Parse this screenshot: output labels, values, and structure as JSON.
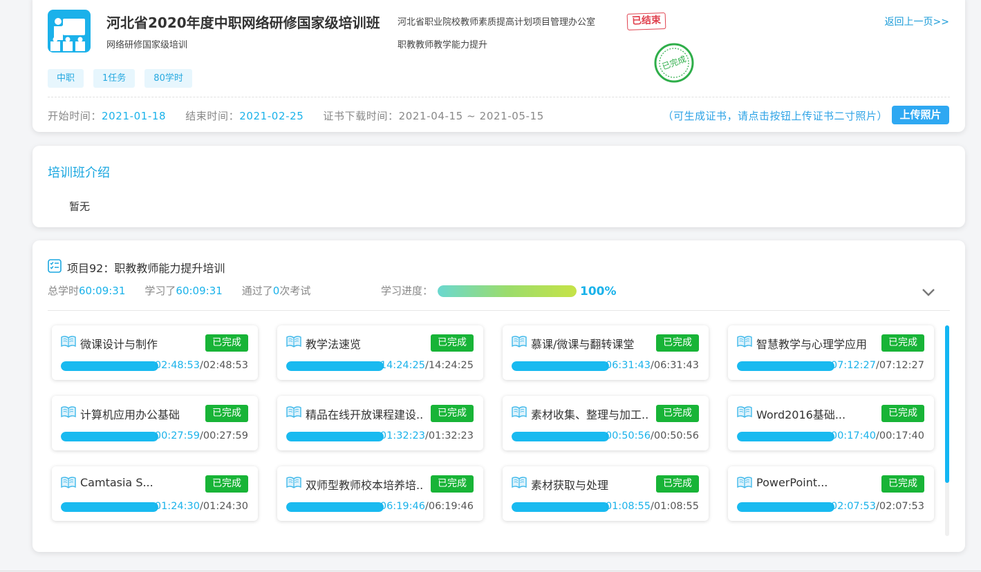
{
  "header": {
    "title": "河北省2020年度中职网络研修国家级培训班",
    "subtitle": "网络研修国家级培训",
    "organization": "河北省职业院校教师素质提高计划项目管理办公室",
    "status_badge": "已结束",
    "category": "职教教师教学能力提升",
    "back_link": "返回上一页>>",
    "stamp_text": "已完成",
    "tags": [
      "中职",
      "1任务",
      "80学时"
    ],
    "start_label": "开始时间：",
    "start_date": "2021-01-18",
    "end_label": "结束时间：",
    "end_date": "2021-02-25",
    "cert_label": "证书下载时间：",
    "cert_range": "2021-04-15 ~ 2021-05-15",
    "cert_note": "（可生成证书，请点击按钮上传证书二寸照片）",
    "upload_button": "上传照片"
  },
  "intro": {
    "title": "培训班介绍",
    "content": "暂无"
  },
  "project": {
    "title": "项目92：职教教师能力提升培训",
    "total_label": "总学时",
    "total_value": "60:09:31",
    "learned_label": "学习了",
    "learned_value": "60:09:31",
    "exam_prefix": "通过了",
    "exam_count": "0",
    "exam_suffix": "次考试",
    "progress_label": "学习进度：",
    "progress_fraction": 1.0,
    "progress_text": "100%"
  },
  "courses": [
    {
      "title": "微课设计与制作",
      "status": "已完成",
      "learned": "02:48:53",
      "total": "/02:48:53",
      "progress": 1.0
    },
    {
      "title": "教学法速览",
      "status": "已完成",
      "learned": "14:24:25",
      "total": "/14:24:25",
      "progress": 1.0
    },
    {
      "title": "慕课/微课与翻转课堂",
      "status": "已完成",
      "learned": "06:31:43",
      "total": "/06:31:43",
      "progress": 1.0
    },
    {
      "title": "智慧教学与心理学应用",
      "status": "已完成",
      "learned": "07:12:27",
      "total": "/07:12:27",
      "progress": 1.0
    },
    {
      "title": "计算机应用办公基础",
      "status": "已完成",
      "learned": "00:27:59",
      "total": "/00:27:59",
      "progress": 1.0
    },
    {
      "title": "精品在线开放课程建设...",
      "status": "已完成",
      "learned": "01:32:23",
      "total": "/01:32:23",
      "progress": 1.0
    },
    {
      "title": "素材收集、整理与加工...",
      "status": "已完成",
      "learned": "00:50:56",
      "total": "/00:50:56",
      "progress": 1.0
    },
    {
      "title": "Word2016基础...",
      "status": "已完成",
      "learned": "00:17:40",
      "total": "/00:17:40",
      "progress": 1.0
    },
    {
      "title": "Camtasia S...",
      "status": "已完成",
      "learned": "01:24:30",
      "total": "/01:24:30",
      "progress": 1.0
    },
    {
      "title": "双师型教师校本培养培...",
      "status": "已完成",
      "learned": "06:19:46",
      "total": "/06:19:46",
      "progress": 1.0
    },
    {
      "title": "素材获取与处理",
      "status": "已完成",
      "learned": "01:08:55",
      "total": "/01:08:55",
      "progress": 1.0
    },
    {
      "title": "PowerPoint...",
      "status": "已完成",
      "learned": "02:07:53",
      "total": "/02:07:53",
      "progress": 1.0
    }
  ],
  "colors": {
    "accent": "#1ab2ea",
    "done_badge": "#18b437",
    "ended_badge": "#e0414e",
    "stamp": "#2fae4a"
  },
  "icons": {
    "course_icon": "teacher-board-icon",
    "project_icon": "checklist-icon",
    "course_card_icon": "open-book-icon",
    "collapse_icon": "chevron-down-icon"
  }
}
